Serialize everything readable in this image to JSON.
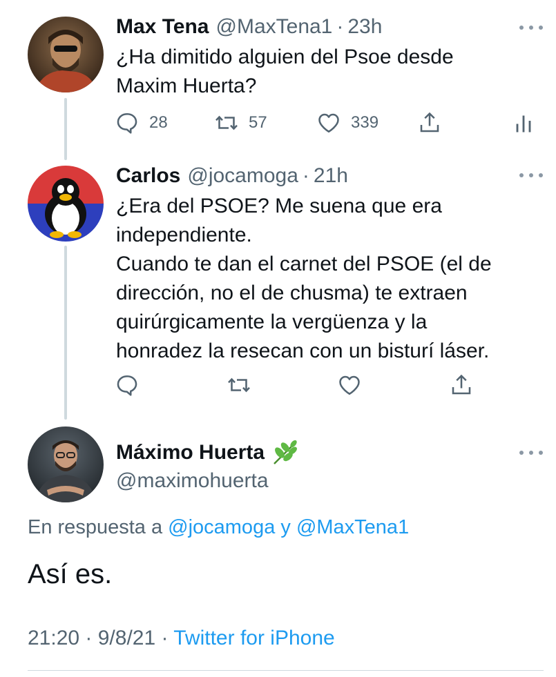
{
  "tweets": [
    {
      "name": "Max Tena",
      "handle": "@MaxTena1",
      "separator": "·",
      "time": "23h",
      "text": "¿Ha dimitido alguien del Psoe desde\nMaxim Huerta?",
      "actions": {
        "replies": "28",
        "retweets": "57",
        "likes": "339"
      }
    },
    {
      "name": "Carlos",
      "handle": "@jocamoga",
      "separator": "·",
      "time": "21h",
      "text": "¿Era del PSOE? Me suena que era\nindependiente.\nCuando te dan el carnet del PSOE (el de\ndirección, no el de chusma) te extraen\nquirúrgicamente la vergüenza y la\nhonradez la resecan con un bisturí láser."
    }
  ],
  "main_tweet": {
    "name": "Máximo Huerta",
    "handle": "@maximohuerta",
    "reply_prefix": "En respuesta a",
    "reply_user1": "@jocamoga",
    "reply_joiner": "y",
    "reply_user2": "@MaxTena1",
    "text": "Así es.",
    "time": "21:20 · 9/8/21 ·",
    "source": "Twitter for iPhone"
  },
  "colors": {
    "link": "#1d9bf0",
    "secondary": "#536471",
    "thread_line": "#cfd9de",
    "leaf": "#5fb944"
  },
  "icons": [
    "reply-icon",
    "retweet-icon",
    "like-icon",
    "share-icon",
    "analytics-icon",
    "more-icon",
    "leaf-icon"
  ]
}
